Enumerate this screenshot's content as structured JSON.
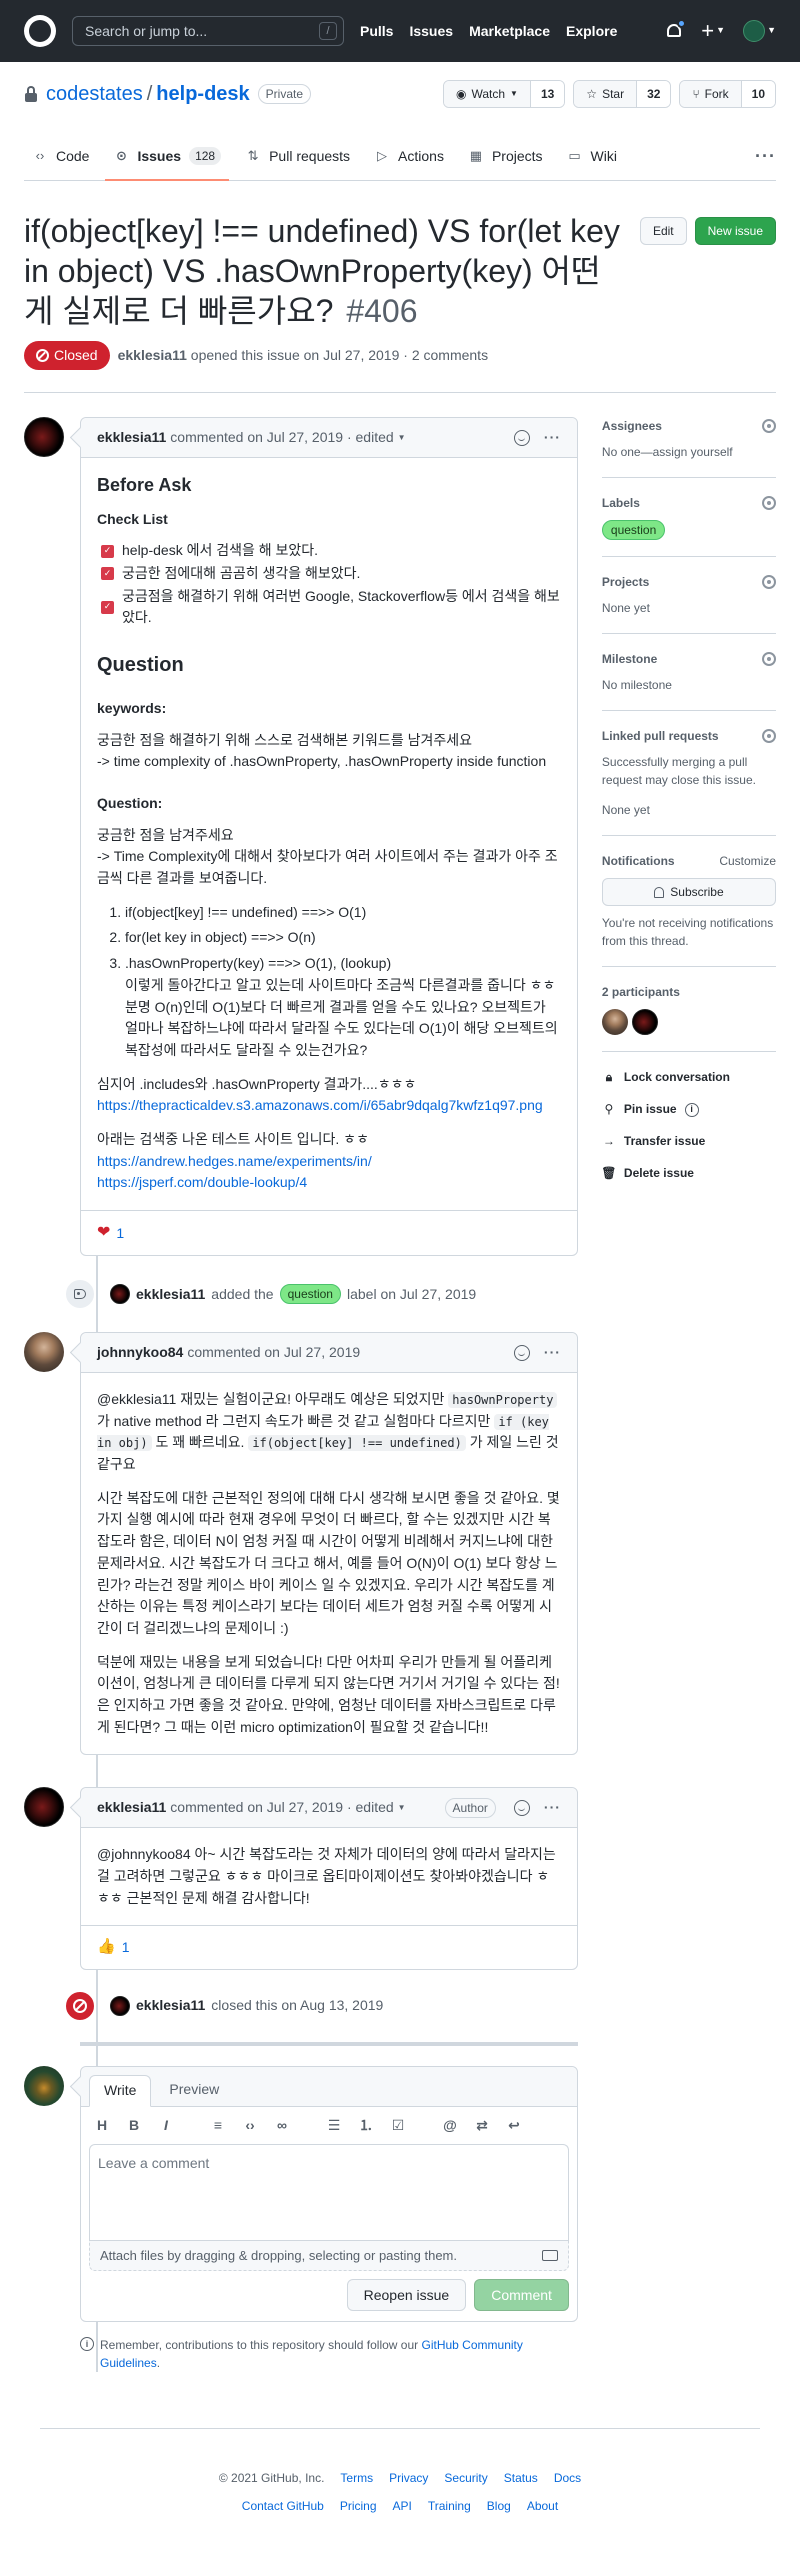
{
  "header": {
    "search_placeholder": "Search or jump to...",
    "search_shortcut": "/",
    "nav": [
      "Pulls",
      "Issues",
      "Marketplace",
      "Explore"
    ],
    "plus_label": "+"
  },
  "repo": {
    "owner": "codestates",
    "separator": "/",
    "name": "help-desk",
    "visibility": "Private",
    "watch_label": "Watch",
    "watch_count": "13",
    "star_label": "Star",
    "star_count": "32",
    "fork_label": "Fork",
    "fork_count": "10",
    "tabs": [
      {
        "label": "Code",
        "icon": "code-icon"
      },
      {
        "label": "Issues",
        "count": "128",
        "icon": "issue-icon"
      },
      {
        "label": "Pull requests",
        "icon": "pull-request-icon"
      },
      {
        "label": "Actions",
        "icon": "play-icon"
      },
      {
        "label": "Projects",
        "icon": "project-icon"
      },
      {
        "label": "Wiki",
        "icon": "book-icon"
      }
    ],
    "more_label": "···"
  },
  "issue": {
    "title": "if(object[key] !== undefined) VS for(let key in object) VS .hasOwnProperty(key) 어떤게 실제로 더 빠른가요?",
    "number": "#406",
    "edit_label": "Edit",
    "new_issue_label": "New issue",
    "state": "Closed",
    "author": "ekklesia11",
    "meta_text": "opened this issue on Jul 27, 2019 · 2 comments"
  },
  "comments": {
    "first": {
      "author": "ekklesia11",
      "meta": "commented on Jul 27, 2019 · edited",
      "heading1": "Before Ask",
      "checklist_title": "Check List",
      "checklist": [
        "help-desk 에서 검색을 해 보았다.",
        "궁금한 점에대해 곰곰히 생각을 해보았다.",
        "궁금점을 해결하기 위해 여러번 Google, Stackoverflow등 에서 검색을 해보았다."
      ],
      "heading2": "Question",
      "keywords_title": "keywords:",
      "keywords_line1": "궁금한 점을 해결하기 위해 스스로 검색해본 키워드를 남겨주세요",
      "keywords_line2": "-> time complexity of .hasOwnProperty, .hasOwnProperty inside function",
      "question_title": "Question:",
      "question_line1": "궁금한 점을 남겨주세요",
      "question_line2": "-> Time Complexity에 대해서 찾아보다가 여러 사이트에서 주는 결과가 아주 조금씩 다른 결과를 보여줍니다.",
      "ordered": [
        "if(object[key] !== undefined) ==>> O(1)",
        "for(let key in object) ==>> O(n)",
        ".hasOwnProperty(key) ==>> O(1), (lookup)"
      ],
      "ordered_detail": "이렇게 돌아간다고 알고 있는데 사이트마다 조금씩 다른결과를 줍니다 ㅎㅎ 분명 O(n)인데 O(1)보다 더 빠르게 결과를 얻을 수도 있나요? 오브젝트가 얼마나 복잡하느냐에 따라서 달라질 수도 있다는데 O(1)이 해당 오브젝트의 복잡성에 따라서도 달라질 수 있는건가요?",
      "p1": "심지어 .includes와 .hasOwnProperty 결과가....ㅎㅎㅎ",
      "link1": "https://thepracticaldev.s3.amazonaws.com/i/65abr9dqalg7kwfz1q97.png",
      "p2": "아래는 검색중 나온 테스트 사이트 입니다. ㅎㅎ",
      "link2": "https://andrew.hedges.name/experiments/in/",
      "link3": "https://jsperf.com/double-lookup/4",
      "reaction_count": "1"
    },
    "label_event": {
      "author": "ekklesia11",
      "before": "added the",
      "label": "question",
      "after": "label on Jul 27, 2019"
    },
    "second": {
      "author": "johnnykoo84",
      "meta": "commented on Jul 27, 2019",
      "para1_a": "@ekklesia11 재밌는 실험이군요! 아무래도 예상은 되었지만",
      "para1_code1": "hasOwnProperty",
      "para1_b": "가 native method 라 그런지 속도가 빠른 것 같고 실험마다 다르지만",
      "para1_code2": "if (key in obj)",
      "para1_c": "도 꽤 빠르네요.",
      "para1_code3": "if(object[key] !== undefined)",
      "para1_d": "가 제일 느린 것 같구요",
      "para2": "시간 복잡도에 대한 근본적인 정의에 대해 다시 생각해 보시면 좋을 것 같아요. 몇 가지 실행 예시에 따라 현재 경우에 무엇이 더 빠르다, 할 수는 있겠지만 시간 복잡도라 함은, 데이터 N이 엄청 커질 때 시간이 어떻게 비례해서 커지느냐에 대한 문제라서요. 시간 복잡도가 더 크다고 해서, 예를 들어 O(N)이 O(1) 보다 항상 느린가? 라는건 정말 케이스 바이 케이스 일 수 있겠지요. 우리가 시간 복잡도를 계산하는 이유는 특정 케이스라기 보다는 데이터 세트가 엄청 커질 수록 어떻게 시간이 더 걸리겠느냐의 문제이니 :)",
      "para3": "덕분에 재밌는 내용을 보게 되었습니다! 다만 어차피 우리가 만들게 될 어플리케이션이, 엄청나게 큰 데이터를 다루게 되지 않는다면 거기서 거기일 수 있다는 점! 은 인지하고 가면 좋을 것 같아요. 만약에, 엄청난 데이터를 자바스크립트로 다루게 된다면? 그 때는 이런 micro optimization이 필요할 것 같습니다!!"
    },
    "third": {
      "author": "ekklesia11",
      "meta": "commented on Jul 27, 2019 · edited",
      "badge": "Author",
      "body": "@johnnykoo84 아~ 시간 복잡도라는 것 자체가 데이터의 양에 따라서 달라지는걸 고려하면 그렇군요 ㅎㅎㅎ 마이크로 옵티마이제이션도 찾아봐야겠습니다 ㅎㅎㅎ 근본적인 문제 해결 감사합니다!",
      "reaction_count": "1"
    },
    "closed_event": {
      "author": "ekklesia11",
      "text": "closed this on Aug 13, 2019"
    }
  },
  "composer": {
    "tab_write": "Write",
    "tab_preview": "Preview",
    "placeholder": "Leave a comment",
    "attach_text": "Attach files by dragging & dropping, selecting or pasting them.",
    "reopen_label": "Reopen issue",
    "comment_label": "Comment",
    "remember_prefix": "Remember, contributions to this repository should follow our",
    "remember_link": "GitHub Community Guidelines",
    "remember_suffix": "."
  },
  "sidebar": {
    "assignees_title": "Assignees",
    "assignees_text": "No one—assign yourself",
    "labels_title": "Labels",
    "label": "question",
    "projects_title": "Projects",
    "projects_text": "None yet",
    "milestone_title": "Milestone",
    "milestone_text": "No milestone",
    "linked_title": "Linked pull requests",
    "linked_text": "Successfully merging a pull request may close this issue.",
    "linked_none": "None yet",
    "notifications_title": "Notifications",
    "customize": "Customize",
    "subscribe": "Subscribe",
    "notif_text": "You're not receiving notifications from this thread.",
    "participants_title": "2 participants",
    "lock": "Lock conversation",
    "pin": "Pin issue",
    "transfer": "Transfer issue",
    "delete": "Delete issue"
  },
  "footer": {
    "copyright": "© 2021 GitHub, Inc.",
    "row1": [
      "Terms",
      "Privacy",
      "Security",
      "Status",
      "Docs"
    ],
    "row2": [
      "Contact GitHub",
      "Pricing",
      "API",
      "Training",
      "Blog",
      "About"
    ]
  }
}
